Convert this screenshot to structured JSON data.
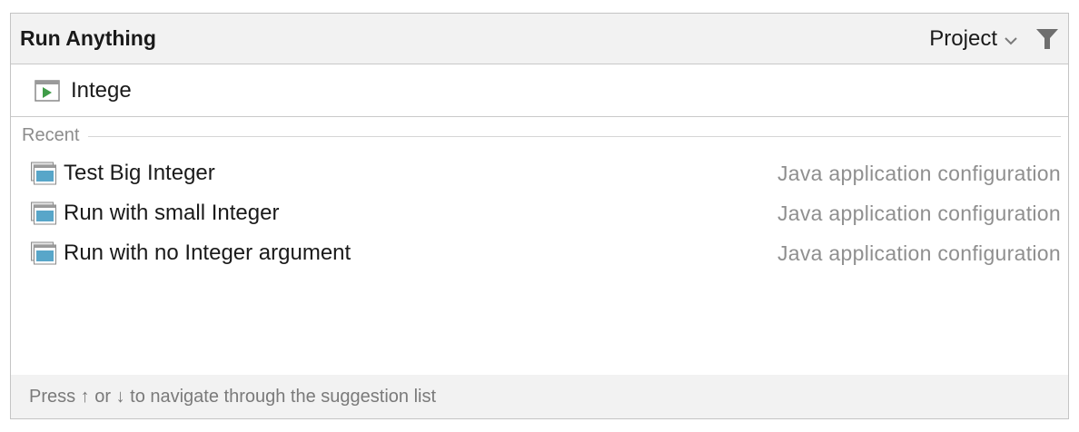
{
  "header": {
    "title": "Run Anything",
    "scope_label": "Project",
    "scope_icon": "chevron-down-icon",
    "filter_icon": "filter-icon"
  },
  "search": {
    "value": "Intege",
    "icon": "run-configuration-icon"
  },
  "recent": {
    "label": "Recent",
    "items": [
      {
        "label": "Test Big Integer",
        "type": "Java application configuration",
        "icon": "application-config-icon"
      },
      {
        "label": "Run with small Integer",
        "type": "Java application configuration",
        "icon": "application-config-icon"
      },
      {
        "label": "Run with no Integer argument",
        "type": "Java application configuration",
        "icon": "application-config-icon"
      }
    ]
  },
  "footer": {
    "hint": "Press ↑ or ↓ to navigate through the suggestion list"
  },
  "colors": {
    "header_bg": "#f2f2f2",
    "icon_accent": "#58a6c9",
    "run_green": "#3f9c48",
    "muted_text": "#8f8f8f"
  }
}
